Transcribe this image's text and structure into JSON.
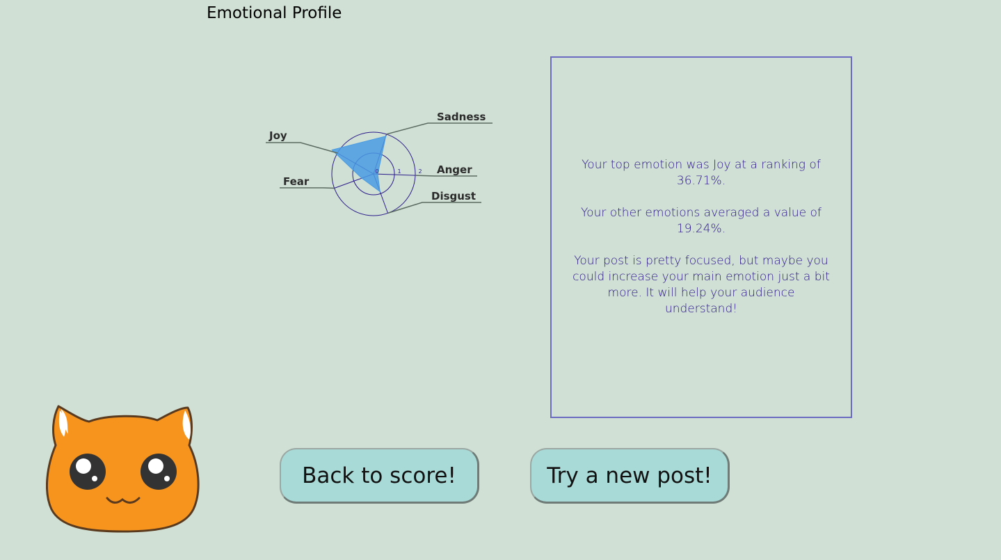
{
  "page": {
    "title": "Emotional Profile"
  },
  "chart_data": {
    "type": "radar",
    "axes": [
      "Sadness",
      "Anger",
      "Disgust",
      "Fear",
      "Joy"
    ],
    "values": [
      1.9,
      0.2,
      0.9,
      0.6,
      2.3
    ],
    "ticks": [
      "0",
      "1",
      "2"
    ],
    "rmax": 2,
    "colors": {
      "fill": "#4a9be3",
      "grid": "#2a1a8a",
      "leader": "#5a6a60"
    }
  },
  "summary": {
    "top_emotion": "Your top emotion was Joy at a ranking of 36.71%.",
    "average": "Your other emotions averaged a value of 19.24%.",
    "advice": "Your post is pretty focused, but maybe you could increase your main emotion just a bit more. It will help your audience understand!"
  },
  "buttons": {
    "back": "Back to score!",
    "new_post": "Try a new post!"
  },
  "mascot": {
    "icon": "cat-face-icon",
    "color": "#f7941d"
  }
}
